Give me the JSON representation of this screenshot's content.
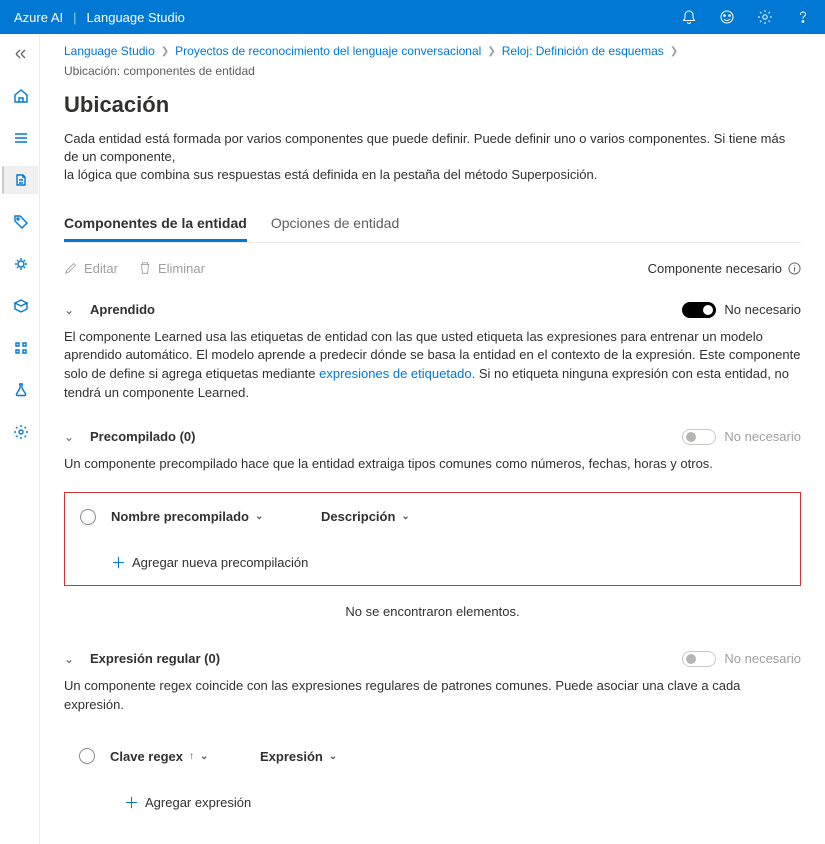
{
  "topbar": {
    "brand_left": "Azure AI",
    "brand_right": "Language Studio"
  },
  "breadcrumb": {
    "items": [
      "Language Studio",
      "Proyectos de reconocimiento del lenguaje conversacional",
      "Reloj: Definición de esquemas"
    ],
    "current": "Ubicación: componentes de entidad"
  },
  "page": {
    "title": "Ubicación",
    "desc_line1": "Cada entidad está formada por varios componentes que puede definir. Puede definir uno o varios componentes. Si tiene más de un componente,",
    "desc_line2": "la lógica que combina sus respuestas está definida en la pestaña del método Superposición."
  },
  "tabs": {
    "active": "Componentes de la entidad",
    "other": "Opciones de entidad"
  },
  "actions": {
    "edit": "Editar",
    "delete": "Eliminar",
    "needed": "Componente necesario"
  },
  "sections": {
    "learned": {
      "title": "Aprendido",
      "toggle_label": "No necesario",
      "desc_before_link": "El componente Learned usa las etiquetas de entidad con las que usted etiqueta las expresiones para entrenar un modelo aprendido automático. El modelo aprende a predecir dónde se basa la entidad en el contexto de la expresión. Este componente solo de define si agrega etiquetas mediante ",
      "desc_link": "expresiones de etiquetado.",
      "desc_after_link": " Si no etiqueta ninguna expresión con esta entidad, no tendrá un componente Learned."
    },
    "prebuilt": {
      "title": "Precompilado (0)",
      "toggle_label": "No necesario",
      "desc": "Un componente precompilado hace que la entidad extraiga tipos comunes como números, fechas, horas y otros.",
      "col1": "Nombre precompilado",
      "col2": "Descripción",
      "add_label": "Agregar nueva precompilación",
      "empty": "No se encontraron elementos."
    },
    "regex": {
      "title": "Expresión regular (0)",
      "toggle_label": "No necesario",
      "desc": "Un componente regex coincide con las expresiones regulares de patrones comunes. Puede asociar una clave a cada expresión.",
      "col1": "Clave regex",
      "col2": "Expresión",
      "add_label": "Agregar expresión"
    }
  }
}
